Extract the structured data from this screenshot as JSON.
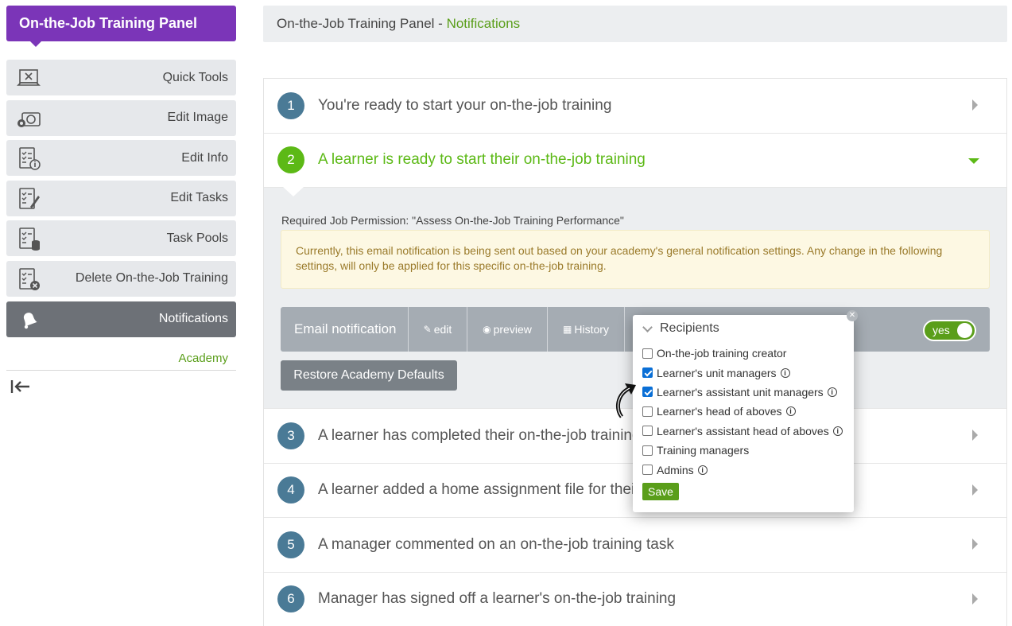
{
  "sidebar": {
    "title": "On-the-Job Training Panel",
    "items": [
      {
        "label": "Quick Tools",
        "icon": "quick-tools-icon"
      },
      {
        "label": "Edit Image",
        "icon": "camera-gear-icon"
      },
      {
        "label": "Edit Info",
        "icon": "checklist-info-icon"
      },
      {
        "label": "Edit Tasks",
        "icon": "checklist-pen-icon"
      },
      {
        "label": "Task Pools",
        "icon": "checklist-database-icon"
      },
      {
        "label": "Delete On-the-Job Training",
        "icon": "checklist-delete-icon"
      },
      {
        "label": "Notifications",
        "icon": "bell-icon",
        "active": true
      }
    ],
    "academy_link": "Academy"
  },
  "header": {
    "breadcrumb_root": "On-the-Job Training Panel",
    "breadcrumb_sep": " - ",
    "breadcrumb_current": "Notifications"
  },
  "notifications": [
    {
      "num": "1",
      "title": "You're ready to start your on-the-job training"
    },
    {
      "num": "2",
      "title": "A learner is ready to start their on-the-job training",
      "open": true
    },
    {
      "num": "3",
      "title": "A learner has completed their on-the-job training"
    },
    {
      "num": "4",
      "title": "A learner added a home assignment file for their on-the-job training"
    },
    {
      "num": "5",
      "title": "A manager commented on an on-the-job training task"
    },
    {
      "num": "6",
      "title": "Manager has signed off a learner's on-the-job training"
    }
  ],
  "detail": {
    "permission": "Required Job Permission: \"Assess On-the-Job Training Performance\"",
    "notice": "Currently, this email notification is being sent out based on your academy's general notification settings. Any change in the following settings, will only be applied for this specific on-the-job training.",
    "email_label": "Email notification",
    "edit_label": "edit",
    "preview_label": "preview",
    "history_label": "History",
    "toggle_label": "yes",
    "restore_label": "Restore Academy Defaults"
  },
  "recipients": {
    "title": "Recipients",
    "options": [
      {
        "label": "On-the-job training creator",
        "checked": false,
        "info": false
      },
      {
        "label": "Learner's unit managers",
        "checked": true,
        "info": true
      },
      {
        "label": "Learner's assistant unit managers",
        "checked": true,
        "info": true
      },
      {
        "label": "Learner's head of aboves",
        "checked": false,
        "info": true
      },
      {
        "label": "Learner's assistant head of aboves",
        "checked": false,
        "info": true
      },
      {
        "label": "Training managers",
        "checked": false,
        "info": false
      },
      {
        "label": "Admins",
        "checked": false,
        "info": true
      }
    ],
    "save_label": "Save"
  },
  "colors": {
    "brand_purple": "#7b35b8",
    "accent_green": "#5cb916",
    "step_blue": "#4a7a96"
  }
}
